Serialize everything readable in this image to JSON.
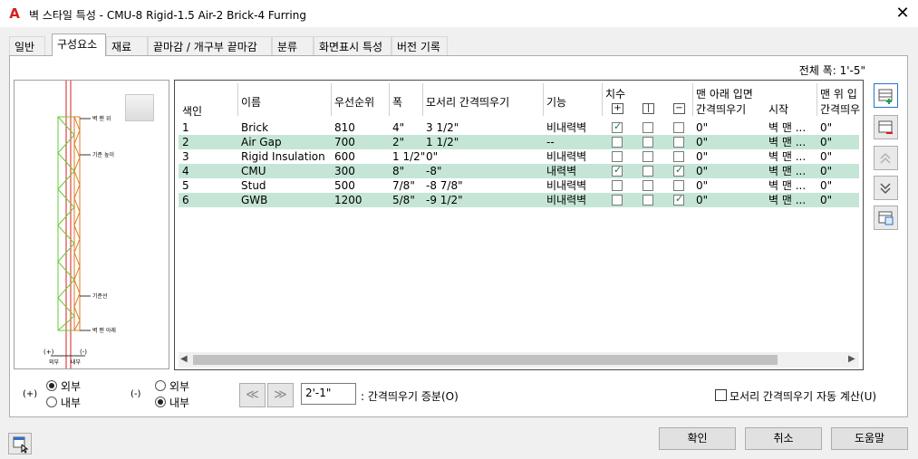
{
  "window": {
    "app_icon": "A",
    "title": "벽 스타일 특성 - CMU-8 Rigid-1.5 Air-2 Brick-4 Furring",
    "close": "✕"
  },
  "tabs": [
    {
      "label": "일반"
    },
    {
      "label": "구성요소",
      "active": true
    },
    {
      "label": "재료"
    },
    {
      "label": "끝마감 / 개구부 끝마감"
    },
    {
      "label": "분류"
    },
    {
      "label": "화면표시 특성"
    },
    {
      "label": "버전 기록"
    }
  ],
  "preview": {
    "labels": [
      "벽 맨 위",
      "기준 높이",
      "기준선",
      "벽 맨 아래"
    ],
    "bottom_plus": "(+)",
    "bottom_minus": "(-)",
    "bottom_out": "외부",
    "bottom_in": "내부"
  },
  "grid": {
    "total_width": "전체 폭: 1'-5\"",
    "headers": {
      "index": "색인",
      "name": "이름",
      "priority": "우선순위",
      "width": "폭",
      "edge_offset": "모서리 간격띄우기",
      "function": "기능",
      "dimension": "치수",
      "bottom_elev": "맨 아래 입면",
      "bottom_offset": "간격띄우기",
      "start": "시작",
      "top_elev": "맨 위 입",
      "top_offset": "간격띄우"
    },
    "rows": [
      {
        "index": "1",
        "name": "Brick",
        "priority": "810",
        "width": "4\"",
        "edge_offset": "3 1/2\"",
        "function": "비내력벽",
        "c1": true,
        "c2": false,
        "c3": false,
        "bottom_offset": "0\"",
        "start": "벽 맨 ...",
        "top_offset": "0\""
      },
      {
        "index": "2",
        "name": "Air Gap",
        "priority": "700",
        "width": "2\"",
        "edge_offset": "1 1/2\"",
        "function": "--",
        "c1": false,
        "c2": false,
        "c3": false,
        "bottom_offset": "0\"",
        "start": "벽 맨 ...",
        "top_offset": "0\""
      },
      {
        "index": "3",
        "name": "Rigid Insulation",
        "priority": "600",
        "width": "1 1/2\"",
        "edge_offset": "0\"",
        "function": "비내력벽",
        "c1": false,
        "c2": false,
        "c3": false,
        "bottom_offset": "0\"",
        "start": "벽 맨 ...",
        "top_offset": "0\""
      },
      {
        "index": "4",
        "name": "CMU",
        "priority": "300",
        "width": "8\"",
        "edge_offset": "-8\"",
        "function": "내력벽",
        "c1": true,
        "c2": false,
        "c3": true,
        "bottom_offset": "0\"",
        "start": "벽 맨 ...",
        "top_offset": "0\""
      },
      {
        "index": "5",
        "name": "Stud",
        "priority": "500",
        "width": "7/8\"",
        "edge_offset": "-8 7/8\"",
        "function": "비내력벽",
        "c1": false,
        "c2": false,
        "c3": false,
        "bottom_offset": "0\"",
        "start": "벽 맨 ...",
        "top_offset": "0\""
      },
      {
        "index": "6",
        "name": "GWB",
        "priority": "1200",
        "width": "5/8\"",
        "edge_offset": "-9 1/2\"",
        "function": "비내력벽",
        "c1": false,
        "c2": false,
        "c3": true,
        "bottom_offset": "0\"",
        "start": "벽 맨 ...",
        "top_offset": "0\""
      }
    ]
  },
  "side_buttons": [
    "add-component-icon",
    "remove-component-icon",
    "move-up-icon",
    "move-down-icon",
    "copy-component-icon"
  ],
  "bottom": {
    "plus_label": "(+)",
    "minus_label": "(-)",
    "plus_outer": "외부",
    "plus_inner": "내부",
    "minus_outer": "외부",
    "minus_inner": "내부",
    "prev": "≪",
    "next": "≫",
    "offset_value": "2'-1\"",
    "offset_label": ": 간격띄우기 증분(O)",
    "auto_calc_label": "모서리 간격띄우기 자동 계산(U)"
  },
  "footer": {
    "ok": "확인",
    "cancel": "취소",
    "help": "도움말"
  }
}
